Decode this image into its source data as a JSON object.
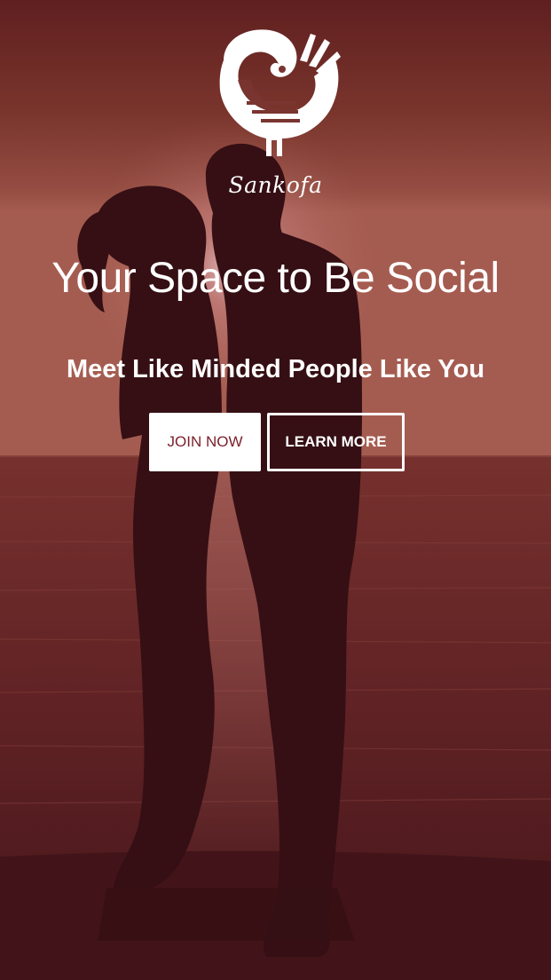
{
  "brand": {
    "name": "Sankofa",
    "logo_icon": "sankofa-bird-icon"
  },
  "hero": {
    "headline": "Your Space to Be Social",
    "subheadline": "Meet Like Minded People Like You",
    "join_label": "JOIN NOW",
    "learn_label": "LEARN MORE",
    "background": "couple-silhouette-sunset-sea"
  },
  "colors": {
    "overlay": "#6a2a22",
    "accent": "#7a1f2c",
    "text": "#ffffff"
  }
}
